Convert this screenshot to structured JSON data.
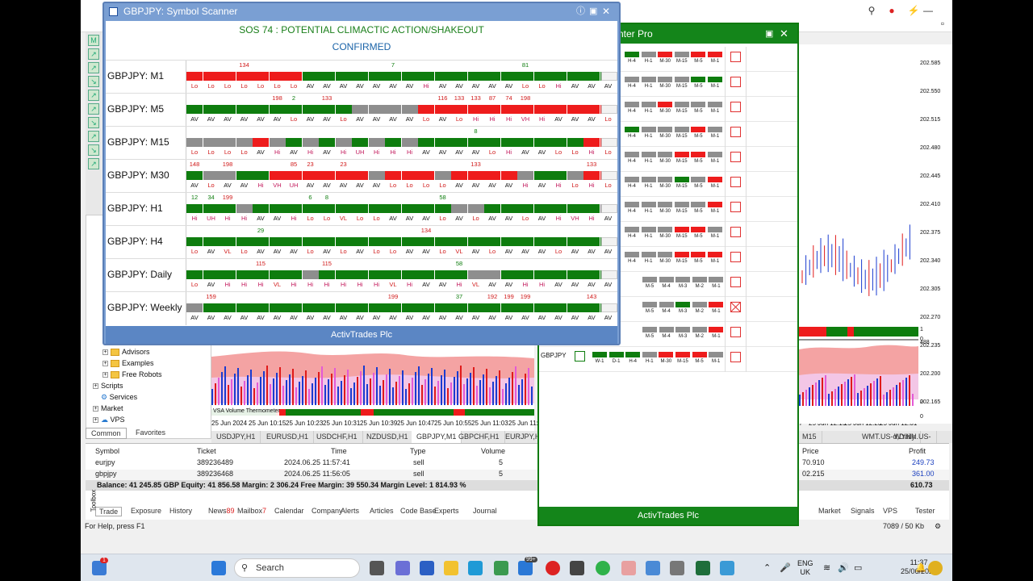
{
  "colors": {
    "green": "#0e7d0e",
    "red": "#ee1c1c",
    "gray": "#8e8e8e",
    "ltgray": "#d6d6d6",
    "blue": "#1a63a8"
  },
  "scanner": {
    "title": "GBPJPY: Symbol Scanner",
    "headline": "SOS  74 : POTENTIAL CLIMACTIC ACTION/SHAKEOUT",
    "subline": "CONFIRMED",
    "footer": "ActivTrades Plc",
    "rows": [
      {
        "label": "GBPJPY: M1",
        "cells": "rrrrrrrrgggggggggggggggggggggggggggg",
        "colors": "RRRRRRRRRRRRGGGGGGGGGGGGGGGGGGGGGGGG",
        "labs": [
          "Lo",
          "Lo",
          "Lo",
          "Lo",
          "Lo",
          "Lo",
          "Lo",
          "AV",
          "AV",
          "AV",
          "AV",
          "AV",
          "AV",
          "AV",
          "Hi",
          "AV",
          "AV",
          "AV",
          "AV",
          "AV",
          "Lo",
          "Lo",
          "Hi",
          "AV",
          "AV",
          "AV"
        ],
        "nums": {
          "3": "134",
          "12": "7",
          "20": "81"
        },
        "seq": "RRRRRRRGGGGGGGGGGGGGGGGGGG"
      },
      {
        "label": "GBPJPY: M5",
        "labs": [
          "AV",
          "AV",
          "AV",
          "AV",
          "AV",
          "AV",
          "Lo",
          "AV",
          "AV",
          "Lo",
          "AV",
          "AV",
          "AV",
          "AV",
          "Lo",
          "AV",
          "Lo",
          "Hi",
          "Hi",
          "Hi",
          "VH",
          "Hi",
          "AV",
          "AV",
          "AV",
          "Lo"
        ],
        "nums": {
          "5": "198",
          "6": "2",
          "8": "133",
          "15": "116",
          "16": "133",
          "17": "133",
          "18": "87",
          "19": "74",
          "20": "198"
        },
        "seq": "GGGGGGGGGGXXXXRRRRRRRRRRRRR"
      },
      {
        "label": "GBPJPY: M15",
        "labs": [
          "Lo",
          "Lo",
          "Lo",
          "Lo",
          "AV",
          "Hi",
          "AV",
          "Hi",
          "AV",
          "Hi",
          "UH",
          "Hi",
          "Hi",
          "Hi",
          "AV",
          "AV",
          "AV",
          "AV",
          "Lo",
          "Hi",
          "AV",
          "AV",
          "Lo",
          "Lo",
          "Hi",
          "Lo"
        ],
        "nums": {
          "17": "8"
        },
        "seq": "XXXXRXGXGXGXGXGGGGGGGGGGRRRR"
      },
      {
        "label": "GBPJPY: M30",
        "labs": [
          "AV",
          "Lo",
          "AV",
          "AV",
          "Hi",
          "VH",
          "UH",
          "AV",
          "AV",
          "AV",
          "AV",
          "AV",
          "Lo",
          "Lo",
          "Lo",
          "Lo",
          "AV",
          "AV",
          "AV",
          "AV",
          "Hi",
          "AV",
          "Hi",
          "Lo",
          "Hi",
          "Lo"
        ],
        "nums": {
          "0": "148",
          "2": "198",
          "6": "85",
          "7": "23",
          "9": "23",
          "17": "133",
          "24": "133"
        },
        "seq": "GXXGGRRRRRRXRRRXRRRRXGGXRR"
      },
      {
        "label": "GBPJPY: H1",
        "labs": [
          "Hi",
          "UH",
          "Hi",
          "Hi",
          "AV",
          "AV",
          "Hi",
          "Lo",
          "Lo",
          "VL",
          "Lo",
          "Lo",
          "AV",
          "AV",
          "AV",
          "Lo",
          "AV",
          "Lo",
          "AV",
          "AV",
          "Lo",
          "AV",
          "Hi",
          "VH",
          "Hi",
          "AV"
        ],
        "nums": {
          "0": "12",
          "1": "34",
          "2": "199",
          "7": "6",
          "8": "8",
          "15": "58"
        },
        "seq": "GGGXGGGGGGGGGGGGXXGGGGGGGX"
      },
      {
        "label": "GBPJPY: H4",
        "labs": [
          "Lo",
          "AV",
          "VL",
          "Lo",
          "AV",
          "AV",
          "AV",
          "Lo",
          "AV",
          "Lo",
          "AV",
          "Lo",
          "Lo",
          "AV",
          "AV",
          "Lo",
          "VL",
          "AV",
          "Lo",
          "AV",
          "AV",
          "AV",
          "Lo",
          "AV",
          "AV",
          "AV"
        ],
        "nums": {
          "4": "29",
          "14": "134"
        },
        "seq": "GGGGGGGGGGGGGGGGGGGGGGGGGG"
      },
      {
        "label": "GBPJPY: Daily",
        "labs": [
          "Lo",
          "AV",
          "Hi",
          "Hi",
          "Hi",
          "VL",
          "Hi",
          "Hi",
          "Hi",
          "Hi",
          "Hi",
          "Hi",
          "VL",
          "Hi",
          "AV",
          "AV",
          "Hi",
          "VL",
          "AV",
          "AV",
          "Hi",
          "Hi",
          "AV",
          "AV",
          "AV",
          "AV"
        ],
        "nums": {
          "4": "115",
          "8": "115",
          "16": "58"
        },
        "seq": "GGGGGGGXGGGGGGGGGXXGGGGGGG"
      },
      {
        "label": "GBPJPY: Weekly",
        "labs": [
          "AV",
          "AV",
          "AV",
          "AV",
          "AV",
          "AV",
          "AV",
          "AV",
          "AV",
          "AV",
          "AV",
          "AV",
          "AV",
          "AV",
          "AV",
          "AV",
          "AV",
          "AV",
          "AV",
          "AV",
          "AV",
          "AV",
          "AV",
          "AV",
          "AV",
          "AV"
        ],
        "nums": {
          "1": "159",
          "12": "199",
          "16": "37",
          "18": "192",
          "19": "199",
          "20": "199",
          "24": "143"
        },
        "seq": "XGGGGGGGGGGGGGGGGGGGGGGGGG"
      }
    ]
  },
  "centerpro": {
    "title": "nter Pro",
    "footer": "ActivTrades Plc",
    "last_symbol": "GBPJPY"
  },
  "chart": {
    "time_labels": [
      "25 Jun 2024",
      "25 Jun 10:15",
      "25 Jun 10:23",
      "25 Jun 10:31",
      "25 Jun 10:39",
      "25 Jun 10:47",
      "25 Jun 10:55",
      "25 Jun 11:03",
      "25 Jun 11:"
    ],
    "right_time_labels": [
      "7",
      "25 Jun 12:15",
      "25 Jun 12:23",
      "25 Jun 12:31"
    ],
    "vsa_label": "VSA Volume Thermometer",
    "prices": [
      "202.585",
      "202.550",
      "202.515",
      "202.480",
      "202.445",
      "202.410",
      "202.375",
      "202.340",
      "202.305",
      "202.270",
      "202.235",
      "202.200",
      "202.165"
    ],
    "indicator_vals": [
      "1",
      "0",
      "488",
      "0",
      "0"
    ]
  },
  "chart_tabs": [
    "USDJPY,H1",
    "EURUSD,H1",
    "USDCHF,H1",
    "NZDUSD,H1",
    "GBPJPY,M1",
    "GBPCHF,H1",
    "EURJPY,H",
    "M15",
    "WMT.US-d,Daily",
    "WYNN.US-"
  ],
  "navigator": {
    "items": [
      "Advisors",
      "Examples",
      "Free Robots",
      "Scripts",
      "Services",
      "Market",
      "VPS"
    ],
    "tabs": [
      "Common",
      "Favorites"
    ]
  },
  "toolbox": {
    "headers": [
      "Symbol",
      "Ticket",
      "Time",
      "Type",
      "Volume",
      "Price",
      "Profit"
    ],
    "rows": [
      {
        "symbol": "eurjpy",
        "ticket": "389236489",
        "time": "2024.06.25 11:57:41",
        "type": "sell",
        "volume": "5",
        "price": "70.910",
        "profit": "249.73"
      },
      {
        "symbol": "gbpjpy",
        "ticket": "389236468",
        "time": "2024.06.25 11:56:05",
        "type": "sell",
        "volume": "5",
        "price": "02.215",
        "profit": "361.00"
      }
    ],
    "balance": "Balance: 41 245.85 GBP  Equity: 41 856.58  Margin: 2 306.24  Free Margin: 39 550.34  Margin Level: 1 814.93 %",
    "total": "610.73",
    "tabs": [
      "Trade",
      "Exposure",
      "History",
      "News",
      "Mailbox",
      "Calendar",
      "Company",
      "Alerts",
      "Articles",
      "Code Base",
      "Experts",
      "Journal"
    ],
    "news_badge": "89",
    "mailbox_badge": "7",
    "right_tabs": [
      "Market",
      "Signals",
      "VPS",
      "Tester"
    ],
    "side_label": "Toolbox"
  },
  "status": {
    "help": "For Help, press F1",
    "traffic": "7089 / 50 Kb"
  },
  "taskbar": {
    "search": "Search",
    "lang1": "ENG",
    "lang2": "UK",
    "time": "11:37",
    "date": "25/06/2024",
    "badge": "99+",
    "notif": "1"
  }
}
